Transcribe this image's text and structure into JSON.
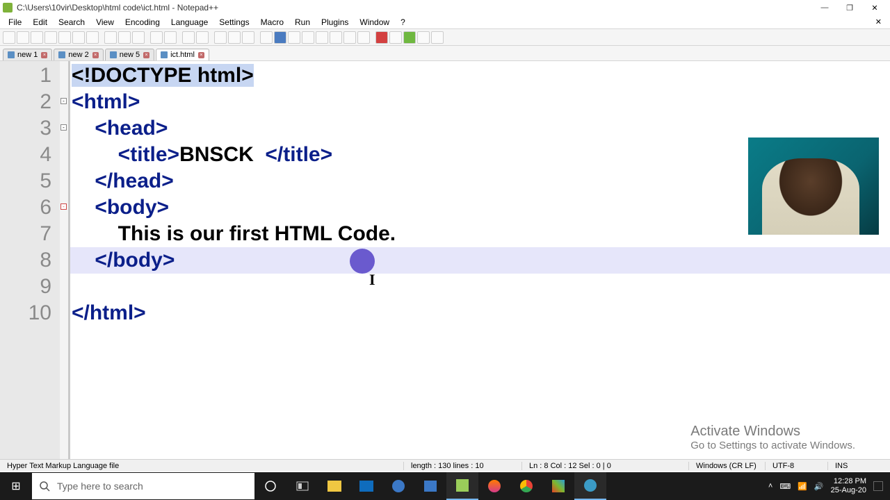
{
  "title": "C:\\Users\\10vir\\Desktop\\html code\\ict.html - Notepad++",
  "menu": {
    "file": "File",
    "edit": "Edit",
    "search": "Search",
    "view": "View",
    "encoding": "Encoding",
    "language": "Language",
    "settings": "Settings",
    "macro": "Macro",
    "run": "Run",
    "plugins": "Plugins",
    "window": "Window",
    "help": "?"
  },
  "tabs": [
    {
      "label": "new 1"
    },
    {
      "label": "new 2"
    },
    {
      "label": "new 5"
    },
    {
      "label": "ict.html",
      "active": true
    }
  ],
  "code": {
    "l1a": "<!",
    "l1b": "DOCTYPE html",
    "l1c": ">",
    "l2": "<html>",
    "l3": "    <head>",
    "l4a": "        <title>",
    "l4b": "BNSCK",
    "l4c": "  </title>",
    "l5": "    </head>",
    "l6": "    <body>",
    "l7": "        This is our first HTML Code.",
    "l8": "    </body>",
    "l9": "",
    "l10": "</html>",
    "nums": {
      "1": "1",
      "2": "2",
      "3": "3",
      "4": "4",
      "5": "5",
      "6": "6",
      "7": "7",
      "8": "8",
      "9": "9",
      "10": "10"
    }
  },
  "status": {
    "filetype": "Hyper Text Markup Language file",
    "length": "length : 130    lines : 10",
    "pos": "Ln : 8    Col : 12    Sel : 0 | 0",
    "eol": "Windows (CR LF)",
    "enc": "UTF-8",
    "mode": "INS"
  },
  "watermark": {
    "t1": "Activate Windows",
    "t2": "Go to Settings to activate Windows."
  },
  "taskbar": {
    "search_placeholder": "Type here to search",
    "time": "12:28 PM",
    "date": "25-Aug-20"
  }
}
